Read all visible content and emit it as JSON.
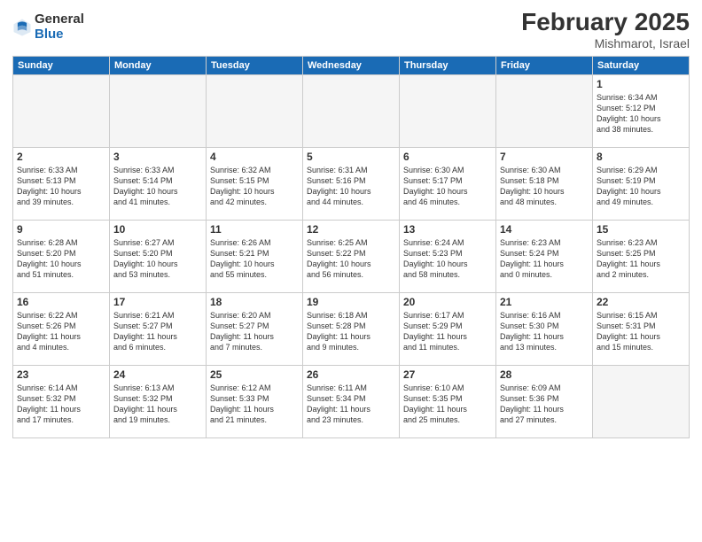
{
  "logo": {
    "general": "General",
    "blue": "Blue"
  },
  "header": {
    "month": "February 2025",
    "location": "Mishmarot, Israel"
  },
  "weekdays": [
    "Sunday",
    "Monday",
    "Tuesday",
    "Wednesday",
    "Thursday",
    "Friday",
    "Saturday"
  ],
  "weeks": [
    [
      {
        "day": "",
        "info": ""
      },
      {
        "day": "",
        "info": ""
      },
      {
        "day": "",
        "info": ""
      },
      {
        "day": "",
        "info": ""
      },
      {
        "day": "",
        "info": ""
      },
      {
        "day": "",
        "info": ""
      },
      {
        "day": "1",
        "info": "Sunrise: 6:34 AM\nSunset: 5:12 PM\nDaylight: 10 hours\nand 38 minutes."
      }
    ],
    [
      {
        "day": "2",
        "info": "Sunrise: 6:33 AM\nSunset: 5:13 PM\nDaylight: 10 hours\nand 39 minutes."
      },
      {
        "day": "3",
        "info": "Sunrise: 6:33 AM\nSunset: 5:14 PM\nDaylight: 10 hours\nand 41 minutes."
      },
      {
        "day": "4",
        "info": "Sunrise: 6:32 AM\nSunset: 5:15 PM\nDaylight: 10 hours\nand 42 minutes."
      },
      {
        "day": "5",
        "info": "Sunrise: 6:31 AM\nSunset: 5:16 PM\nDaylight: 10 hours\nand 44 minutes."
      },
      {
        "day": "6",
        "info": "Sunrise: 6:30 AM\nSunset: 5:17 PM\nDaylight: 10 hours\nand 46 minutes."
      },
      {
        "day": "7",
        "info": "Sunrise: 6:30 AM\nSunset: 5:18 PM\nDaylight: 10 hours\nand 48 minutes."
      },
      {
        "day": "8",
        "info": "Sunrise: 6:29 AM\nSunset: 5:19 PM\nDaylight: 10 hours\nand 49 minutes."
      }
    ],
    [
      {
        "day": "9",
        "info": "Sunrise: 6:28 AM\nSunset: 5:20 PM\nDaylight: 10 hours\nand 51 minutes."
      },
      {
        "day": "10",
        "info": "Sunrise: 6:27 AM\nSunset: 5:20 PM\nDaylight: 10 hours\nand 53 minutes."
      },
      {
        "day": "11",
        "info": "Sunrise: 6:26 AM\nSunset: 5:21 PM\nDaylight: 10 hours\nand 55 minutes."
      },
      {
        "day": "12",
        "info": "Sunrise: 6:25 AM\nSunset: 5:22 PM\nDaylight: 10 hours\nand 56 minutes."
      },
      {
        "day": "13",
        "info": "Sunrise: 6:24 AM\nSunset: 5:23 PM\nDaylight: 10 hours\nand 58 minutes."
      },
      {
        "day": "14",
        "info": "Sunrise: 6:23 AM\nSunset: 5:24 PM\nDaylight: 11 hours\nand 0 minutes."
      },
      {
        "day": "15",
        "info": "Sunrise: 6:23 AM\nSunset: 5:25 PM\nDaylight: 11 hours\nand 2 minutes."
      }
    ],
    [
      {
        "day": "16",
        "info": "Sunrise: 6:22 AM\nSunset: 5:26 PM\nDaylight: 11 hours\nand 4 minutes."
      },
      {
        "day": "17",
        "info": "Sunrise: 6:21 AM\nSunset: 5:27 PM\nDaylight: 11 hours\nand 6 minutes."
      },
      {
        "day": "18",
        "info": "Sunrise: 6:20 AM\nSunset: 5:27 PM\nDaylight: 11 hours\nand 7 minutes."
      },
      {
        "day": "19",
        "info": "Sunrise: 6:18 AM\nSunset: 5:28 PM\nDaylight: 11 hours\nand 9 minutes."
      },
      {
        "day": "20",
        "info": "Sunrise: 6:17 AM\nSunset: 5:29 PM\nDaylight: 11 hours\nand 11 minutes."
      },
      {
        "day": "21",
        "info": "Sunrise: 6:16 AM\nSunset: 5:30 PM\nDaylight: 11 hours\nand 13 minutes."
      },
      {
        "day": "22",
        "info": "Sunrise: 6:15 AM\nSunset: 5:31 PM\nDaylight: 11 hours\nand 15 minutes."
      }
    ],
    [
      {
        "day": "23",
        "info": "Sunrise: 6:14 AM\nSunset: 5:32 PM\nDaylight: 11 hours\nand 17 minutes."
      },
      {
        "day": "24",
        "info": "Sunrise: 6:13 AM\nSunset: 5:32 PM\nDaylight: 11 hours\nand 19 minutes."
      },
      {
        "day": "25",
        "info": "Sunrise: 6:12 AM\nSunset: 5:33 PM\nDaylight: 11 hours\nand 21 minutes."
      },
      {
        "day": "26",
        "info": "Sunrise: 6:11 AM\nSunset: 5:34 PM\nDaylight: 11 hours\nand 23 minutes."
      },
      {
        "day": "27",
        "info": "Sunrise: 6:10 AM\nSunset: 5:35 PM\nDaylight: 11 hours\nand 25 minutes."
      },
      {
        "day": "28",
        "info": "Sunrise: 6:09 AM\nSunset: 5:36 PM\nDaylight: 11 hours\nand 27 minutes."
      },
      {
        "day": "",
        "info": ""
      }
    ]
  ]
}
